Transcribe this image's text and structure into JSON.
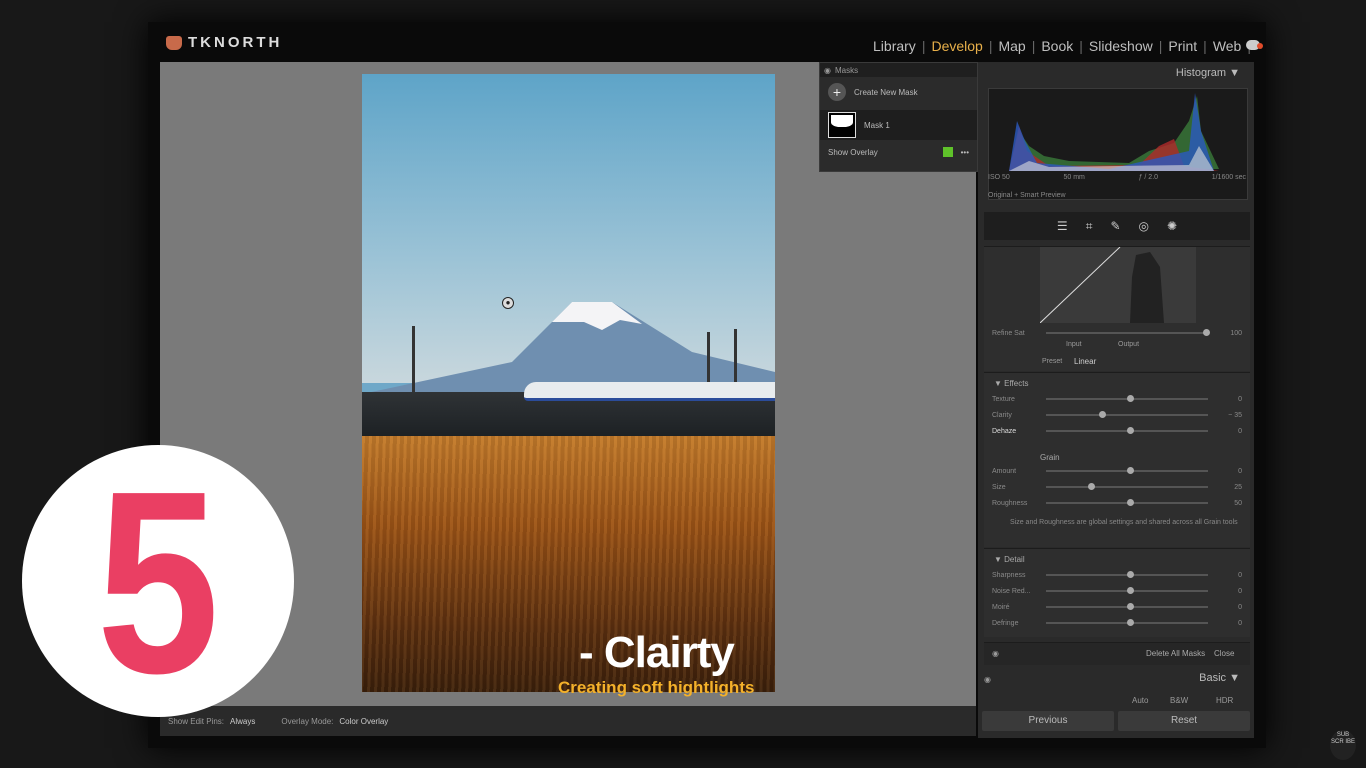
{
  "brand": {
    "logo_text": "TKNORTH"
  },
  "modules": [
    {
      "label": "Library",
      "active": false
    },
    {
      "label": "Develop",
      "active": true
    },
    {
      "label": "Map",
      "active": false
    },
    {
      "label": "Book",
      "active": false
    },
    {
      "label": "Slideshow",
      "active": false
    },
    {
      "label": "Print",
      "active": false
    },
    {
      "label": "Web",
      "active": false
    }
  ],
  "masks_panel": {
    "title": "Masks",
    "create_label": "Create New Mask",
    "mask_name": "Mask 1",
    "show_overlay": "Show Overlay"
  },
  "histogram": {
    "title": "Histogram",
    "iso": "ISO 50",
    "focal": "50 mm",
    "aperture": "ƒ / 2.0",
    "shutter": "1/1600 sec",
    "preview": "Original + Smart Preview"
  },
  "curve": {
    "refine_label": "Refine Sat",
    "input_label": "Input",
    "output_label": "Output",
    "preset_label": "Preset",
    "preset_value": "Linear"
  },
  "effects": {
    "title": "Effects",
    "rows": [
      {
        "label": "Texture",
        "value": "0",
        "pos": 0.5
      },
      {
        "label": "Clarity",
        "value": "− 35",
        "pos": 0.33
      },
      {
        "label": "Dehaze",
        "value": "0",
        "pos": 0.5
      }
    ],
    "grain_title": "Grain",
    "grain_rows": [
      {
        "label": "Amount",
        "value": "0",
        "pos": 0.5
      },
      {
        "label": "Size",
        "value": "25",
        "pos": 0.26
      },
      {
        "label": "Roughness",
        "value": "50",
        "pos": 0.5
      }
    ],
    "note": "Size and Roughness are global settings and shared across all Grain tools"
  },
  "detail": {
    "title": "Detail",
    "rows": [
      {
        "label": "Sharpness",
        "value": "0",
        "pos": 0.5
      },
      {
        "label": "Noise Red...",
        "value": "0",
        "pos": 0.5
      },
      {
        "label": "Moiré",
        "value": "0",
        "pos": 0.5
      },
      {
        "label": "Defringe",
        "value": "0",
        "pos": 0.5
      }
    ]
  },
  "mask_actions": {
    "delete_all": "Delete All Masks",
    "close": "Close"
  },
  "basic": {
    "title": "Basic",
    "auto": "Auto",
    "bw": "B&W",
    "hdr": "HDR"
  },
  "buttons": {
    "previous": "Previous",
    "reset": "Reset"
  },
  "bottom_toolbar": {
    "pins_label": "Show Edit Pins:",
    "pins_value": "Always",
    "overlay_label": "Overlay Mode:",
    "overlay_value": "Color Overlay"
  },
  "overlay": {
    "number": "5",
    "caption_title": "- Clairty",
    "caption_sub": "Creating soft hightlights",
    "subscribe": "SUB SCR IBE"
  },
  "colors": {
    "accent": "#e8b04a",
    "badge_pink": "#ea3f63",
    "caption_yellow": "#f4b12a"
  }
}
